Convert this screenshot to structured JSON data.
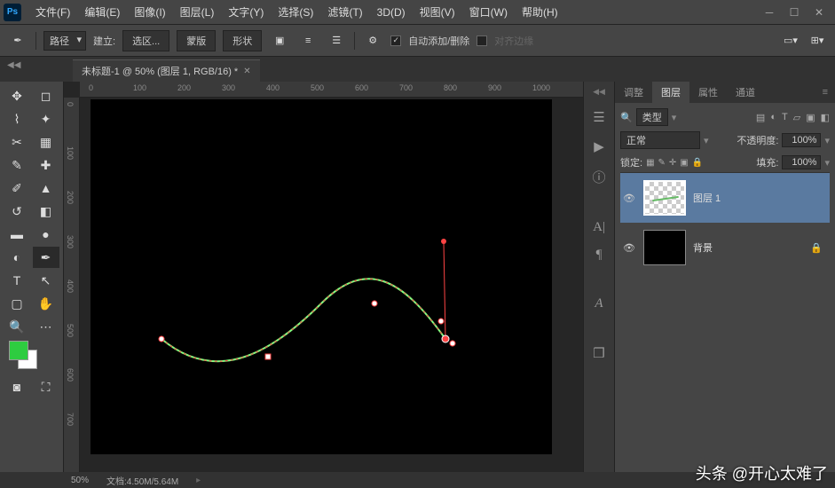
{
  "menubar": {
    "items": [
      "文件(F)",
      "编辑(E)",
      "图像(I)",
      "图层(L)",
      "文字(Y)",
      "选择(S)",
      "滤镜(T)",
      "3D(D)",
      "视图(V)",
      "窗口(W)",
      "帮助(H)"
    ]
  },
  "optbar": {
    "mode": "路径",
    "build_label": "建立:",
    "btn_selection": "选区...",
    "btn_mask": "蒙版",
    "btn_shape": "形状",
    "auto_add_delete": "自动添加/删除",
    "align_edges": "对齐边缘"
  },
  "tab": {
    "title": "未标题-1 @ 50% (图层 1, RGB/16) *"
  },
  "ruler_h": [
    "0",
    "100",
    "200",
    "300",
    "400",
    "500",
    "600",
    "700",
    "800",
    "900",
    "1000"
  ],
  "ruler_v": [
    "0",
    "100",
    "200",
    "300",
    "400",
    "500",
    "600",
    "700"
  ],
  "panels": {
    "tabs": [
      "调整",
      "图层",
      "属性",
      "通道"
    ],
    "filter_label": "类型",
    "blend_mode": "正常",
    "opacity_label": "不透明度:",
    "opacity_value": "100%",
    "lock_label": "锁定:",
    "fill_label": "填充:",
    "fill_value": "100%",
    "layers": [
      {
        "name": "图层 1",
        "locked": false
      },
      {
        "name": "背景",
        "locked": true
      }
    ]
  },
  "status": {
    "zoom": "50%",
    "doc": "文档:4.50M/5.64M"
  },
  "watermark": "头条 @开心太难了",
  "colors": {
    "fg": "#2ecc40",
    "bg": "#ffffff"
  }
}
